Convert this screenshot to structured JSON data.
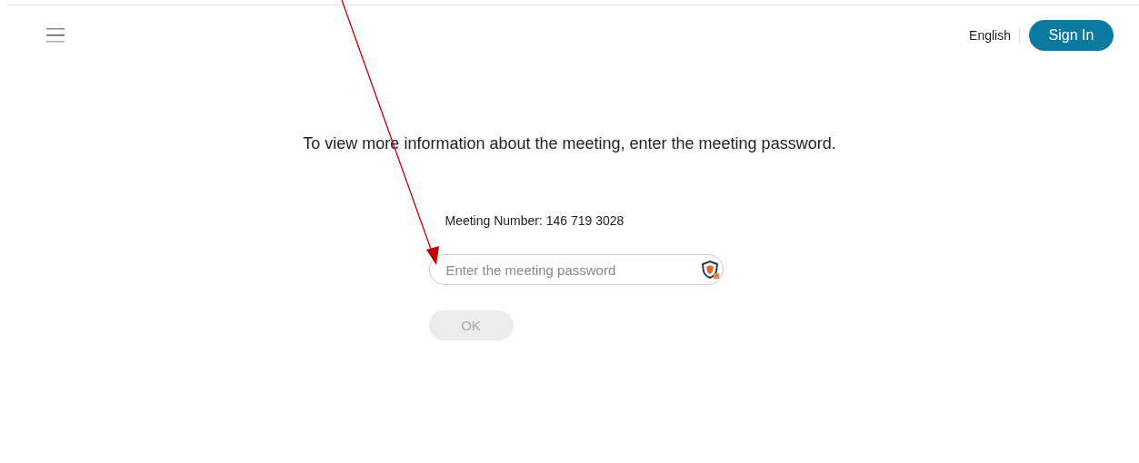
{
  "header": {
    "language": "English",
    "sign_in": "Sign In"
  },
  "message": "To view more information about the meeting, enter the meeting password.",
  "meeting_number": "Meeting Number: 146 719 3028",
  "password_field": {
    "placeholder": "Enter the meeting password"
  },
  "ok_button": {
    "label": "OK",
    "disabled": true
  }
}
